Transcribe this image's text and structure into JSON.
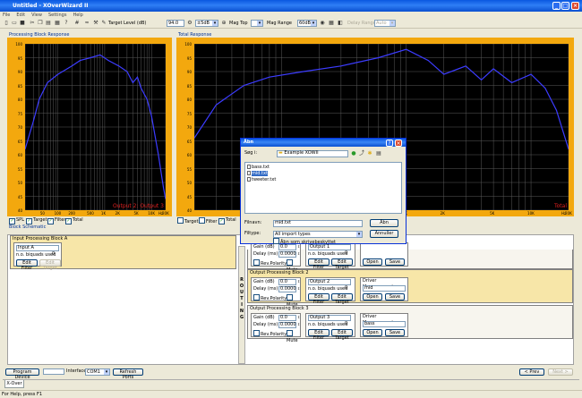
{
  "window": {
    "title": "Untitled - XOverWizard II"
  },
  "menu": [
    "File",
    "Edit",
    "View",
    "Settings",
    "Help"
  ],
  "toolbar": {
    "target_level_label": "Target Level (dB)",
    "target_level_value": "94.0",
    "step_value": "±5dB",
    "mag_top_label": "Mag Top",
    "mag_range_label": "Mag Range",
    "mag_range_value": "60dB",
    "delay_range_label": "Delay Range",
    "delay_range_value": "Auto"
  },
  "charts": {
    "left_title": "Processing Block Response",
    "right_title": "Total Response",
    "left_overlay": "Output 2: Output 3",
    "right_overlay": "Total",
    "y_ticks": [
      "100",
      "95",
      "90",
      "85",
      "80",
      "75",
      "70",
      "65",
      "60",
      "55",
      "50",
      "45",
      "40"
    ],
    "left_x_ticks": [
      "50",
      "100",
      "200",
      "500",
      "1K",
      "2K",
      "5K",
      "10K",
      "20K",
      "Hz"
    ],
    "right_x_ticks": [
      "50",
      "100",
      "200",
      "500",
      "1K",
      "2K",
      "5K",
      "10K",
      "20K",
      "Hz"
    ]
  },
  "chart_data": [
    {
      "type": "line",
      "title": "Processing Block Response",
      "ylim": [
        40,
        100
      ],
      "xlim": [
        20,
        20000
      ],
      "xscale": "log",
      "series": [
        {
          "values": [
            [
              20,
              62
            ],
            [
              30,
              72
            ],
            [
              40,
              80
            ],
            [
              60,
              86
            ],
            [
              100,
              89
            ],
            [
              200,
              92
            ],
            [
              300,
              94
            ],
            [
              500,
              95
            ],
            [
              800,
              96
            ],
            [
              1200,
              94
            ],
            [
              2000,
              92
            ],
            [
              3000,
              90
            ],
            [
              4000,
              86
            ],
            [
              5000,
              88
            ],
            [
              6000,
              84
            ],
            [
              8000,
              80
            ],
            [
              10000,
              74
            ],
            [
              14000,
              60
            ],
            [
              18000,
              48
            ],
            [
              20000,
              44
            ]
          ]
        }
      ]
    },
    {
      "type": "line",
      "title": "Total Response",
      "ylim": [
        40,
        100
      ],
      "xlim": [
        20,
        20000
      ],
      "xscale": "log",
      "series": [
        {
          "values": [
            [
              20,
              66
            ],
            [
              30,
              78
            ],
            [
              50,
              85
            ],
            [
              80,
              88
            ],
            [
              150,
              90
            ],
            [
              300,
              92
            ],
            [
              600,
              95
            ],
            [
              1000,
              98
            ],
            [
              1500,
              94
            ],
            [
              2000,
              89
            ],
            [
              3000,
              92
            ],
            [
              4000,
              87
            ],
            [
              5000,
              91
            ],
            [
              7000,
              86
            ],
            [
              10000,
              89
            ],
            [
              13000,
              84
            ],
            [
              16000,
              76
            ],
            [
              20000,
              62
            ]
          ]
        }
      ]
    }
  ],
  "legend": {
    "spl": "SPL",
    "target": "Target",
    "filter": "Filter",
    "total": "Total"
  },
  "block_schematic_label": "Block Schematic",
  "input_block": {
    "title": "Input Processing Block A",
    "input_value": "Input A",
    "biquads_label": "n.o. biquads used",
    "biquads_value": "0",
    "edit_filter": "Edit Filter",
    "edit_target": "Edit Target"
  },
  "routing_letters": [
    "R",
    "O",
    "U",
    "T",
    "I",
    "N",
    "G"
  ],
  "output_blocks": [
    {
      "title": "Output Processing Block 1",
      "gain": "0.0",
      "delay": "0.0000",
      "output_value": "Output 1",
      "biquads": "0",
      "driver": "",
      "open": "Open",
      "save": "Save"
    },
    {
      "title": "Output Processing Block 2",
      "gain": "0.0",
      "delay": "0.0000",
      "output_value": "Output 2",
      "biquads": "0",
      "driver": "mid",
      "open": "Open",
      "save": "Save"
    },
    {
      "title": "Output Processing Block 3",
      "gain": "0.0",
      "delay": "0.0000",
      "output_value": "Output 3",
      "biquads": "0",
      "driver": "bass",
      "open": "Open",
      "save": "Save"
    }
  ],
  "output_labels": {
    "gain": "Gain (dB)",
    "delay": "Delay (ms)",
    "rev_polarity": "Rev.Polarity",
    "mute": "Mute",
    "biquads": "n.o. biquads used",
    "edit_filter": "Edit Filter",
    "edit_target": "Edit Target",
    "driver_measurement": "Driver Measurement"
  },
  "dialog": {
    "title": "Åbn",
    "look_in_label": "Søg i:",
    "look_in_value": "Example XOWII",
    "files": [
      "bass.txt",
      "mid.txt",
      "tweeter.txt"
    ],
    "filename_label": "Filnavn:",
    "filename_value": "mid.txt",
    "filetype_label": "Filtype:",
    "filetype_value": "All import types",
    "readonly_label": "Åbn som skrivebeskyttet",
    "open_btn": "Åbn",
    "cancel_btn": "Annuller"
  },
  "bottom": {
    "program_device": "Program Device",
    "interface_label": "Interface",
    "interface_value": "COM1",
    "refresh_ports": "Refresh Ports",
    "prev": "< Prev",
    "next": "Next >",
    "tab": "X-Over"
  },
  "status": "For Help, press F1"
}
